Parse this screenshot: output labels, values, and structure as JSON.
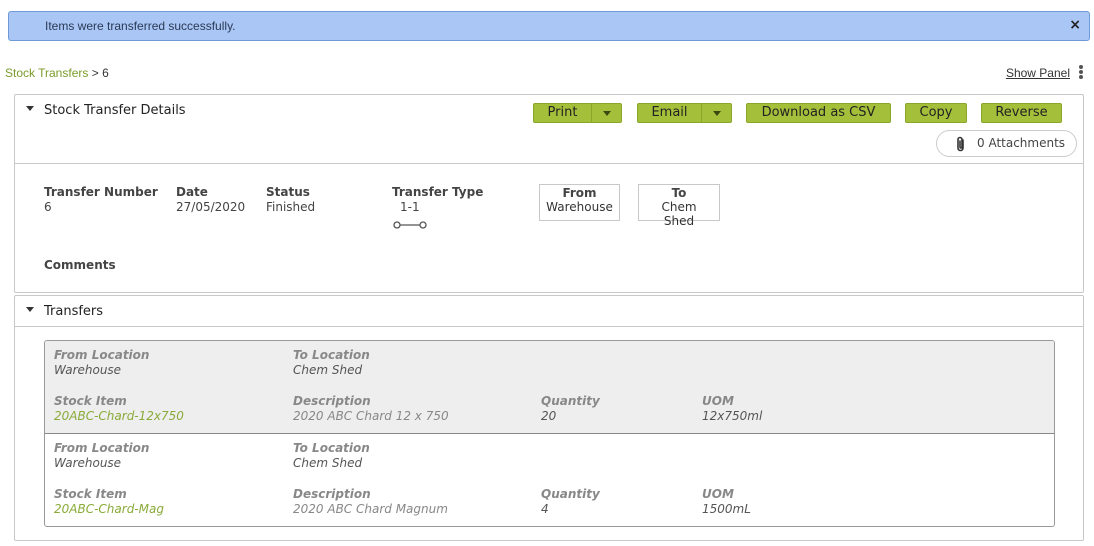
{
  "alert": {
    "message": "Items were transferred successfully.",
    "close": "×"
  },
  "breadcrumb": {
    "parent": "Stock Transfers",
    "separator": ">",
    "current": "6"
  },
  "header": {
    "show_panel": "Show Panel"
  },
  "details": {
    "title": "Stock Transfer Details",
    "buttons": {
      "print": "Print",
      "email": "Email",
      "csv": "Download as CSV",
      "copy": "Copy",
      "reverse": "Reverse"
    },
    "attachments": "0 Attachments",
    "fields": {
      "transfer_number": {
        "label": "Transfer Number",
        "value": "6"
      },
      "date": {
        "label": "Date",
        "value": "27/05/2020"
      },
      "status": {
        "label": "Status",
        "value": "Finished"
      },
      "transfer_type": {
        "label": "Transfer Type",
        "value": "1-1"
      },
      "from": {
        "label": "From",
        "value": "Warehouse"
      },
      "to": {
        "label": "To",
        "value": "Chem Shed"
      },
      "comments": {
        "label": "Comments"
      }
    }
  },
  "transfers": {
    "title": "Transfers",
    "labels": {
      "from_location": "From Location",
      "to_location": "To Location",
      "stock_item": "Stock Item",
      "description": "Description",
      "quantity": "Quantity",
      "uom": "UOM"
    },
    "rows": [
      {
        "from_location": "Warehouse",
        "to_location": "Chem Shed",
        "stock_item": "20ABC-Chard-12x750",
        "description": "2020 ABC Chard 12 x 750",
        "quantity": "20",
        "uom": "12x750ml"
      },
      {
        "from_location": "Warehouse",
        "to_location": "Chem Shed",
        "stock_item": "20ABC-Chard-Mag",
        "description": "2020 ABC Chard Magnum",
        "quantity": "4",
        "uom": "1500mL"
      }
    ]
  }
}
